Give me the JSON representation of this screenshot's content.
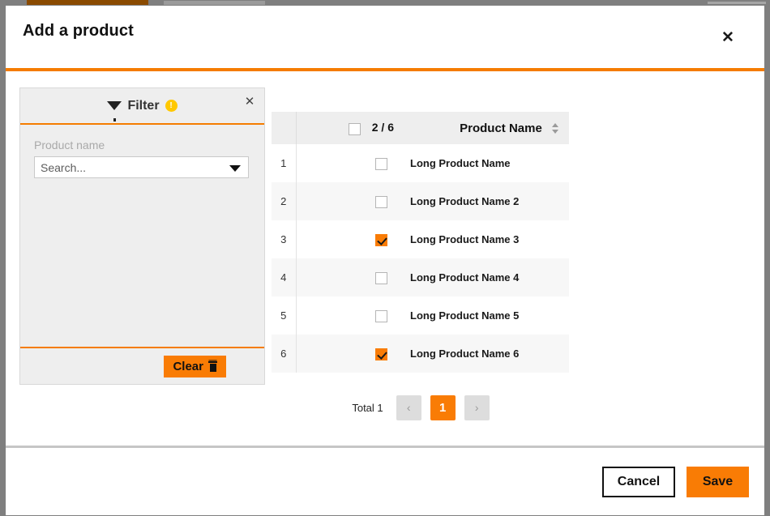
{
  "modal": {
    "title": "Add a product",
    "close_icon": "close-icon"
  },
  "filter": {
    "title": "Filter",
    "badge": "!",
    "funnel_icon": "funnel-icon",
    "close_icon": "close-icon",
    "field_label": "Product name",
    "search_placeholder": "Search...",
    "search_value": "",
    "dropdown_icon": "chevron-down-icon",
    "clear_label": "Clear",
    "clear_icon": "trash-icon"
  },
  "table": {
    "header": {
      "select_all_checked": false,
      "count": "2 / 6",
      "name_column": "Product Name",
      "sort_icon": "sort-updown-icon"
    },
    "rows": [
      {
        "index": "1",
        "checked": false,
        "name": "Long Product Name"
      },
      {
        "index": "2",
        "checked": false,
        "name": "Long Product Name 2"
      },
      {
        "index": "3",
        "checked": true,
        "name": "Long Product Name 3"
      },
      {
        "index": "4",
        "checked": false,
        "name": "Long Product Name 4"
      },
      {
        "index": "5",
        "checked": false,
        "name": "Long Product Name 5"
      },
      {
        "index": "6",
        "checked": true,
        "name": "Long Product Name 6"
      }
    ]
  },
  "pagination": {
    "total_label": "Total 1",
    "prev_icon": "‹",
    "pages": [
      "1"
    ],
    "current_page": "1",
    "next_icon": "›"
  },
  "footer": {
    "cancel_label": "Cancel",
    "save_label": "Save"
  },
  "colors": {
    "accent": "#f97c05",
    "header_rule": "#f57c00",
    "badge": "#ffc800",
    "panel_bg": "#eeeeee",
    "row_alt": "#f7f7f7"
  }
}
